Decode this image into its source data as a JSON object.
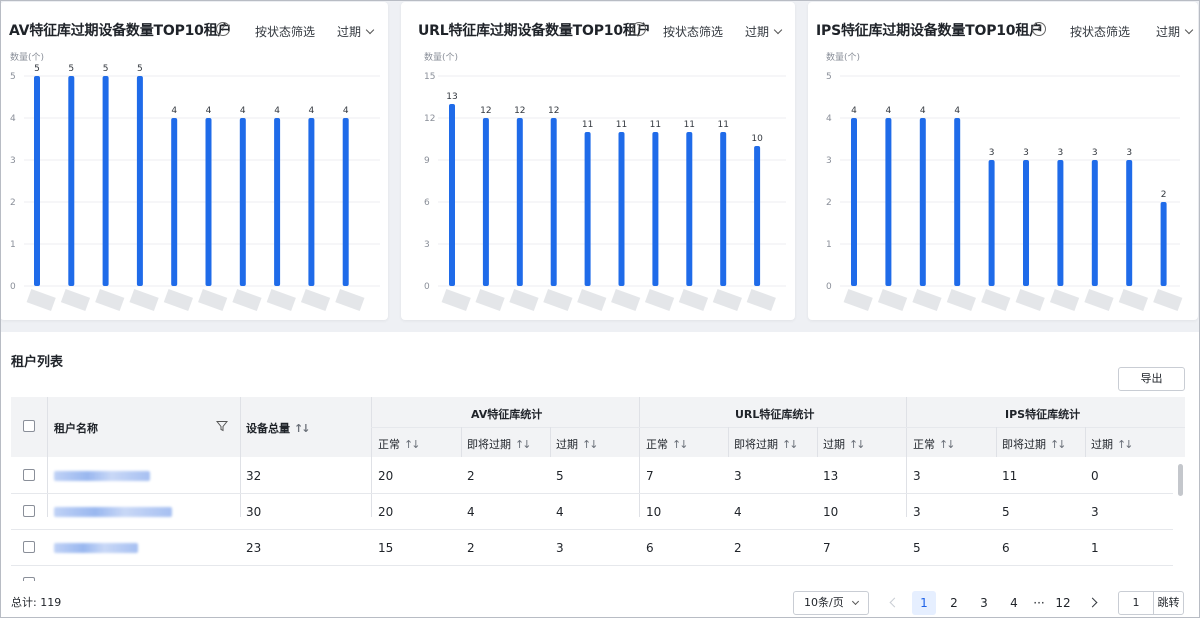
{
  "charts": [
    {
      "title": "AV特征库过期设备数量TOP10租户",
      "filter_label": "按状态筛选",
      "select_value": "过期",
      "chart_data": {
        "type": "bar",
        "ylabel": "数量(个)",
        "yticks": [
          0,
          1,
          2,
          3,
          4,
          5
        ],
        "ylim": [
          0,
          5
        ],
        "categories": [
          "",
          "",
          "",
          "",
          "",
          "",
          "",
          "",
          "",
          ""
        ],
        "values": [
          5,
          5,
          5,
          5,
          4,
          4,
          4,
          4,
          4,
          4
        ],
        "bar_color": "#1f6be9",
        "grid": true
      }
    },
    {
      "title": "URL特征库过期设备数量TOP10租户",
      "filter_label": "按状态筛选",
      "select_value": "过期",
      "chart_data": {
        "type": "bar",
        "ylabel": "数量(个)",
        "yticks": [
          0,
          3,
          6,
          9,
          12,
          15
        ],
        "ylim": [
          0,
          15
        ],
        "categories": [
          "",
          "",
          "",
          "",
          "",
          "",
          "",
          "",
          "",
          ""
        ],
        "values": [
          13,
          12,
          12,
          12,
          11,
          11,
          11,
          11,
          11,
          10
        ],
        "bar_color": "#1f6be9",
        "grid": true
      }
    },
    {
      "title": "IPS特征库过期设备数量TOP10租户",
      "filter_label": "按状态筛选",
      "select_value": "过期",
      "chart_data": {
        "type": "bar",
        "ylabel": "数量(个)",
        "yticks": [
          0,
          1,
          2,
          3,
          4,
          5
        ],
        "ylim": [
          0,
          5
        ],
        "categories": [
          "",
          "",
          "",
          "",
          "",
          "",
          "",
          "",
          "",
          ""
        ],
        "values": [
          4,
          4,
          4,
          4,
          3,
          3,
          3,
          3,
          3,
          2
        ],
        "bar_color": "#1f6be9",
        "grid": true
      }
    }
  ],
  "list": {
    "title": "租户列表",
    "export_label": "导出",
    "headers": {
      "tenant": "租户名称",
      "total": "设备总量",
      "av_group": "AV特征库统计",
      "url_group": "URL特征库统计",
      "ips_group": "IPS特征库统计",
      "normal": "正常",
      "expiring": "即将过期",
      "expired": "过期",
      "sort_glyph": "↑↓"
    },
    "rows": [
      {
        "total": "32",
        "av": [
          "20",
          "2",
          "5"
        ],
        "url": [
          "7",
          "3",
          "13"
        ],
        "ips": [
          "3",
          "11",
          "0"
        ]
      },
      {
        "total": "30",
        "av": [
          "20",
          "4",
          "4"
        ],
        "url": [
          "10",
          "4",
          "10"
        ],
        "ips": [
          "3",
          "5",
          "3"
        ]
      },
      {
        "total": "23",
        "av": [
          "15",
          "2",
          "3"
        ],
        "url": [
          "6",
          "2",
          "7"
        ],
        "ips": [
          "5",
          "6",
          "1"
        ]
      }
    ]
  },
  "footer": {
    "total_text": "总计: 119",
    "page_size": "10条/页",
    "pages": [
      "1",
      "2",
      "3",
      "4",
      "···",
      "12"
    ],
    "current_page": "1",
    "jump_value": "1",
    "jump_label": "跳转"
  },
  "colors": {
    "accent": "#1f6be9",
    "header_bg": "#f2f3f5"
  }
}
